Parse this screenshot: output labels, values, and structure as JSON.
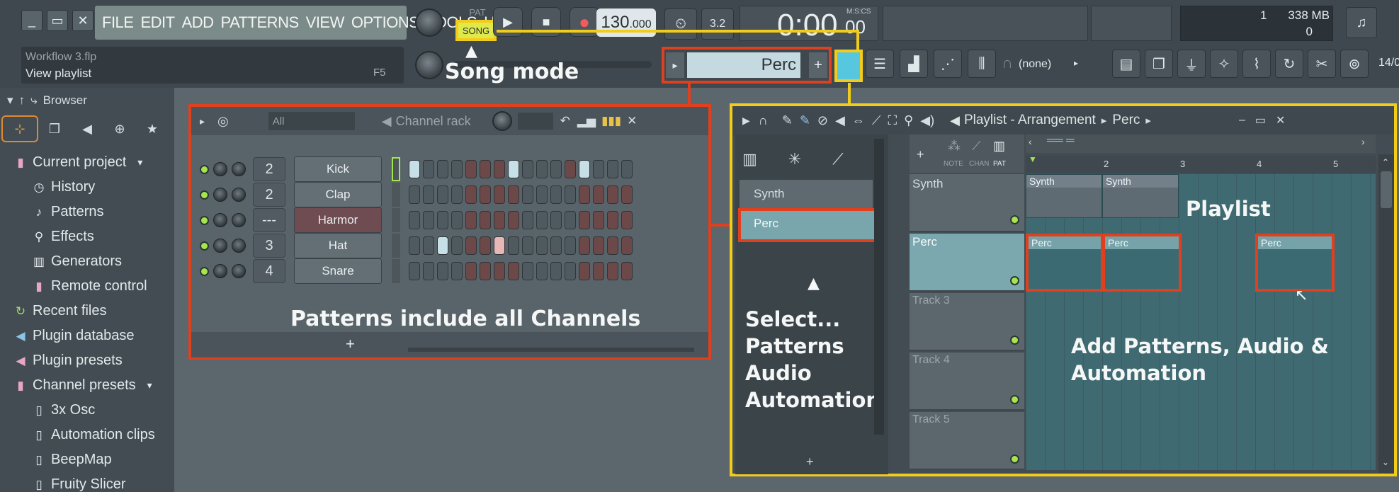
{
  "menu": {
    "items": [
      "FILE",
      "EDIT",
      "ADD",
      "PATTERNS",
      "VIEW",
      "OPTIONS",
      "TOOLS",
      "HELP"
    ]
  },
  "transport": {
    "pat_label": "PAT",
    "song_label": "SONG",
    "tempo_int": "130",
    "tempo_dec": ".000",
    "time_main": "0:00",
    "time_sub": "00",
    "time_unit": "M:S:CS",
    "beat_display": "3.2"
  },
  "status": {
    "cpu": "1",
    "memory": "338 MB",
    "polyphony": "0"
  },
  "project": {
    "filename": "Workflow 3.flp",
    "hint": "View playlist",
    "hint_key": "F5"
  },
  "pattern_selector": {
    "value": "Perc",
    "none_value": "(none)",
    "date": "14/0"
  },
  "browser": {
    "title": "Browser",
    "items": [
      {
        "label": "Current project",
        "icon": "folder-icon"
      },
      {
        "label": "History",
        "icon": "history-icon"
      },
      {
        "label": "Patterns",
        "icon": "note-icon"
      },
      {
        "label": "Effects",
        "icon": "effects-icon"
      },
      {
        "label": "Generators",
        "icon": "keyboard-icon"
      },
      {
        "label": "Remote control",
        "icon": "remote-icon"
      },
      {
        "label": "Recent files",
        "icon": "recent-icon"
      },
      {
        "label": "Plugin database",
        "icon": "plugin-icon"
      },
      {
        "label": "Plugin presets",
        "icon": "plugin-icon"
      },
      {
        "label": "Channel presets",
        "icon": "folder-icon"
      },
      {
        "label": "3x Osc",
        "icon": "preset-icon"
      },
      {
        "label": "Automation clips",
        "icon": "preset-icon"
      },
      {
        "label": "BeepMap",
        "icon": "preset-icon"
      },
      {
        "label": "Fruity Slicer",
        "icon": "preset-icon"
      }
    ]
  },
  "channel_rack": {
    "title": "Channel rack",
    "filter": "All",
    "add_label": "+",
    "channels": [
      {
        "name": "Kick",
        "number": "2",
        "steps": "wgggrrrwgggrwgggrrrr"
      },
      {
        "name": "Clap",
        "number": "2",
        "steps": "ggggrrrrggggrrrrrrrr"
      },
      {
        "name": "Harmor",
        "number": "---",
        "steps": "ggggrrrrggggrrrrrrrr"
      },
      {
        "name": "Hat",
        "number": "3",
        "steps": "ggwgrrpgggggrrrrrpr"
      },
      {
        "name": "Snare",
        "number": "4",
        "steps": "ggggrrrrggggrrrrrrrr"
      }
    ]
  },
  "playlist": {
    "title": "Playlist - Arrangement",
    "pattern_crumb": "Perc",
    "picker_patterns": [
      "Synth",
      "Perc"
    ],
    "tab_labels": [
      "NOTE",
      "CHAN",
      "PAT"
    ],
    "tracks": [
      "Synth",
      "Perc",
      "Track 3",
      "Track 4",
      "Track 5"
    ],
    "bar_numbers": [
      "2",
      "3",
      "4",
      "5"
    ],
    "clip_synth": "Synth",
    "clip_perc": "Perc",
    "add_label": "+"
  },
  "annotations": {
    "song_mode": "Song mode",
    "patterns_include": "Patterns include all Channels",
    "select": [
      "Select...",
      "Patterns",
      "Audio",
      "Automation"
    ],
    "playlist": "Playlist",
    "add_patterns": [
      "Add Patterns, Audio &",
      "Automation"
    ]
  },
  "colors": {
    "annotation_red": "#e0401e",
    "annotation_yellow": "#f2cc1b",
    "accent_teal": "#7aa8ae"
  }
}
